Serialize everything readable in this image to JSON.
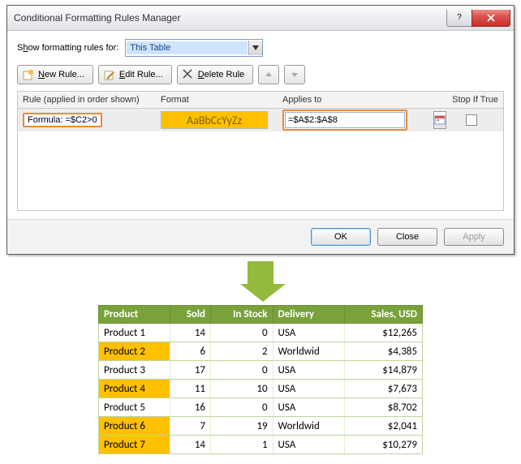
{
  "dialog": {
    "title": "Conditional Formatting Rules Manager",
    "show_label_pre": "S",
    "show_label_u": "h",
    "show_label_post": "ow formatting rules for:",
    "scope_value": "This Table",
    "toolbar": {
      "new_u": "N",
      "new_rest": "ew Rule...",
      "edit_u": "E",
      "edit_rest": "dit Rule...",
      "del_u": "D",
      "del_rest": "elete Rule"
    },
    "headers": {
      "rule": "Rule (applied in order shown)",
      "format": "Format",
      "applies": "Applies to",
      "stop": "Stop If True"
    },
    "rule": {
      "name": "Formula: =$C2>0",
      "preview_text": "AaBbCcYyZz",
      "applies_to": "=$A$2:$A$8"
    },
    "buttons": {
      "ok": "OK",
      "close": "Close",
      "apply": "Apply"
    }
  },
  "sheet": {
    "headers": [
      "Product",
      "Sold",
      "In Stock",
      "Delivery",
      "Sales,  USD"
    ],
    "rows": [
      {
        "p": "Product 1",
        "sold": "14",
        "stock": "0",
        "del": "USA",
        "sales": "$12,265",
        "hl": false
      },
      {
        "p": "Product 2",
        "sold": "6",
        "stock": "2",
        "del": "Worldwid",
        "sales": "$4,385",
        "hl": true
      },
      {
        "p": "Product 3",
        "sold": "17",
        "stock": "0",
        "del": "USA",
        "sales": "$14,879",
        "hl": false
      },
      {
        "p": "Product 4",
        "sold": "11",
        "stock": "10",
        "del": "USA",
        "sales": "$7,673",
        "hl": true
      },
      {
        "p": "Product 5",
        "sold": "16",
        "stock": "0",
        "del": "USA",
        "sales": "$8,702",
        "hl": false
      },
      {
        "p": "Product 6",
        "sold": "7",
        "stock": "19",
        "del": "Worldwid",
        "sales": "$2,041",
        "hl": true
      },
      {
        "p": "Product 7",
        "sold": "14",
        "stock": "1",
        "del": "USA",
        "sales": "$10,279",
        "hl": true
      }
    ]
  }
}
